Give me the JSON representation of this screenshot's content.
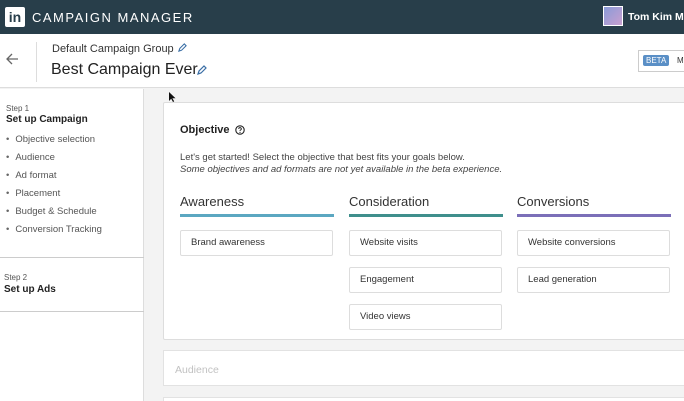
{
  "topbar": {
    "logo_text": "in",
    "app_title": "CAMPAIGN MANAGER",
    "user_name": "Tom Kim Ma"
  },
  "header": {
    "group_name": "Default Campaign Group",
    "campaign_name": "Best Campaign Ever",
    "beta_badge": "BETA",
    "beta_text": "M"
  },
  "sidebar": {
    "step1_label": "Step 1",
    "step1_title": "Set up Campaign",
    "step1_items": [
      "Objective selection",
      "Audience",
      "Ad format",
      "Placement",
      "Budget & Schedule",
      "Conversion Tracking"
    ],
    "step2_label": "Step 2",
    "step2_title": "Set up Ads"
  },
  "objective": {
    "title": "Objective",
    "intro": "Let's get started! Select the objective that best fits your goals below.",
    "note": "Some objectives and ad formats are not yet available in the beta experience.",
    "columns": [
      {
        "title": "Awareness",
        "color": "#5ba7c1",
        "options": [
          "Brand awareness"
        ]
      },
      {
        "title": "Consideration",
        "color": "#3f8f8c",
        "options": [
          "Website visits",
          "Engagement",
          "Video views"
        ]
      },
      {
        "title": "Conversions",
        "color": "#7b6fb8",
        "options": [
          "Website conversions",
          "Lead generation"
        ]
      }
    ]
  },
  "audience": {
    "title": "Audience"
  }
}
